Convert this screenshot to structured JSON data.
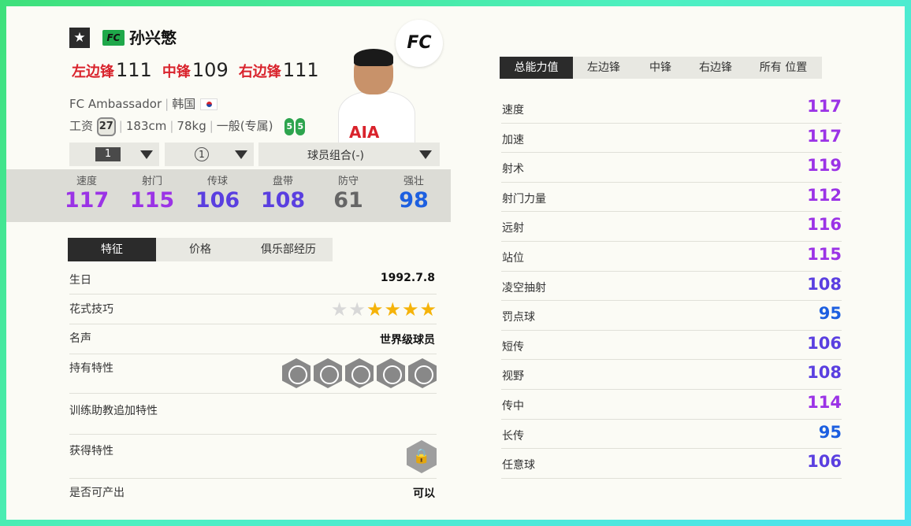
{
  "header": {
    "star_icon": "★",
    "fc_badge": "FC",
    "player_name": "孙兴慜",
    "positions": [
      {
        "name": "左边锋",
        "value": "111"
      },
      {
        "name": "中锋",
        "value": "109"
      },
      {
        "name": "右边锋",
        "value": "111"
      }
    ],
    "team": "FC Ambassador",
    "country": "韩国",
    "salary": "27",
    "height": "183cm",
    "weight": "78kg",
    "body_type": "一般(专属)",
    "weak_foot": "5",
    "strong_foot": "5",
    "sponsor": "AIA",
    "logo": "FC"
  },
  "selectors": {
    "level": "1",
    "rank": "1",
    "combo": "球员组合(-)"
  },
  "summary_stats": [
    {
      "label": "速度",
      "value": "117",
      "color": "#9b33e6"
    },
    {
      "label": "射门",
      "value": "115",
      "color": "#9b33e6"
    },
    {
      "label": "传球",
      "value": "106",
      "color": "#5a3fe0"
    },
    {
      "label": "盘带",
      "value": "108",
      "color": "#5a3fe0"
    },
    {
      "label": "防守",
      "value": "61",
      "color": "#666666"
    },
    {
      "label": "强壮",
      "value": "98",
      "color": "#1d5fe0"
    }
  ],
  "left_tabs": [
    "特征",
    "价格",
    "俱乐部经历"
  ],
  "features": {
    "birthday": {
      "label": "生日",
      "value": "1992.7.8"
    },
    "skill_moves": {
      "label": "花式技巧",
      "rating": 5,
      "max": 7
    },
    "reputation": {
      "label": "名声",
      "value": "世界级球员"
    },
    "traits": {
      "label": "持有特性",
      "icons": [
        "finesse-shot-icon",
        "power-header-icon",
        "long-shot-icon",
        "speed-dribbler-icon",
        "flair-icon"
      ]
    },
    "training_traits": {
      "label": "训练助教追加特性"
    },
    "acquired_traits": {
      "label": "获得特性",
      "icon": "lock-icon"
    },
    "can_produce": {
      "label": "是否可产出",
      "value": "可以"
    }
  },
  "right_tabs": [
    "总能力值",
    "左边锋",
    "中锋",
    "右边锋",
    "所有 位置"
  ],
  "attributes": [
    {
      "label": "速度",
      "value": "117",
      "color": "#9b33e6"
    },
    {
      "label": "加速",
      "value": "117",
      "color": "#9b33e6"
    },
    {
      "label": "射术",
      "value": "119",
      "color": "#9b33e6"
    },
    {
      "label": "射门力量",
      "value": "112",
      "color": "#9b33e6"
    },
    {
      "label": "远射",
      "value": "116",
      "color": "#9b33e6"
    },
    {
      "label": "站位",
      "value": "115",
      "color": "#9b33e6"
    },
    {
      "label": "凌空抽射",
      "value": "108",
      "color": "#5a3fe0"
    },
    {
      "label": "罚点球",
      "value": "95",
      "color": "#1d5fe0"
    },
    {
      "label": "短传",
      "value": "106",
      "color": "#5a3fe0"
    },
    {
      "label": "视野",
      "value": "108",
      "color": "#5a3fe0"
    },
    {
      "label": "传中",
      "value": "114",
      "color": "#9b33e6"
    },
    {
      "label": "长传",
      "value": "95",
      "color": "#1d5fe0"
    },
    {
      "label": "任意球",
      "value": "106",
      "color": "#5a3fe0"
    }
  ]
}
